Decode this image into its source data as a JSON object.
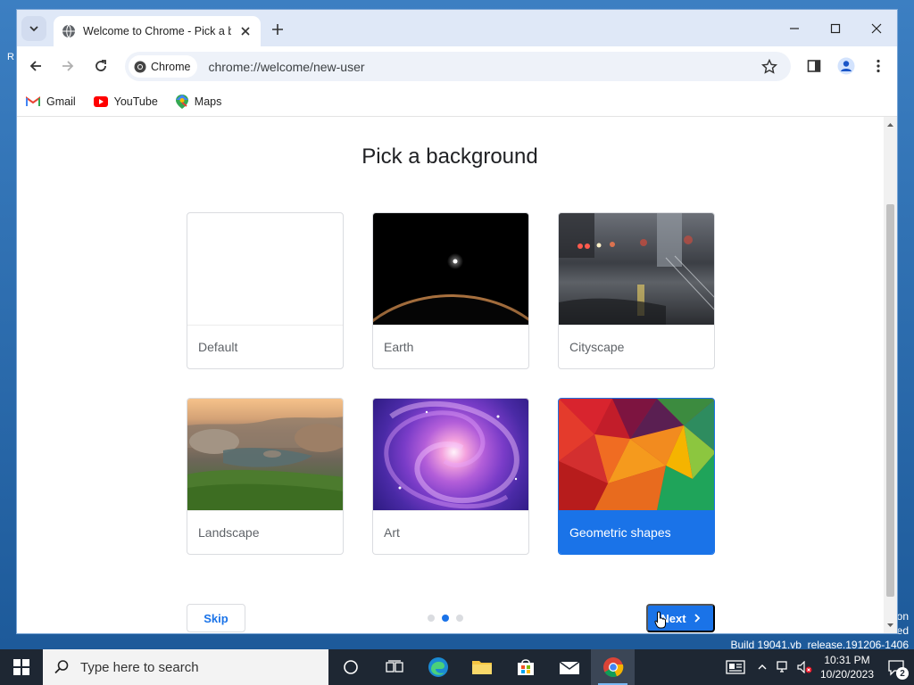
{
  "desktop": {
    "edge_letter": "R",
    "watermark_lines": [
      "on",
      "ed",
      "Build 19041.vb_release.191206-1406"
    ]
  },
  "browser": {
    "tab_title": "Welcome to Chrome - Pick a b",
    "omnibox_chip": "Chrome",
    "url": "chrome://welcome/new-user",
    "bookmarks": [
      {
        "label": "Gmail",
        "icon": "gmail-icon"
      },
      {
        "label": "YouTube",
        "icon": "youtube-icon"
      },
      {
        "label": "Maps",
        "icon": "maps-icon"
      }
    ]
  },
  "page": {
    "heading": "Pick a background",
    "cards": [
      {
        "label": "Default",
        "image": "blank"
      },
      {
        "label": "Earth",
        "image": "earth"
      },
      {
        "label": "Cityscape",
        "image": "cityscape"
      },
      {
        "label": "Landscape",
        "image": "landscape"
      },
      {
        "label": "Art",
        "image": "art"
      },
      {
        "label": "Geometric shapes",
        "image": "geometric",
        "selected": true
      }
    ],
    "skip_label": "Skip",
    "next_label": "Next",
    "progress_dots": {
      "count": 3,
      "active_index": 1
    }
  },
  "taskbar": {
    "search_placeholder": "Type here to search",
    "time": "10:31 PM",
    "date": "10/20/2023",
    "notification_count": "2",
    "apps": [
      "task-view",
      "edge",
      "file-explorer",
      "store",
      "mail",
      "chrome"
    ]
  },
  "colors": {
    "accent": "#1a73e8",
    "taskbar": "#1e2733"
  }
}
